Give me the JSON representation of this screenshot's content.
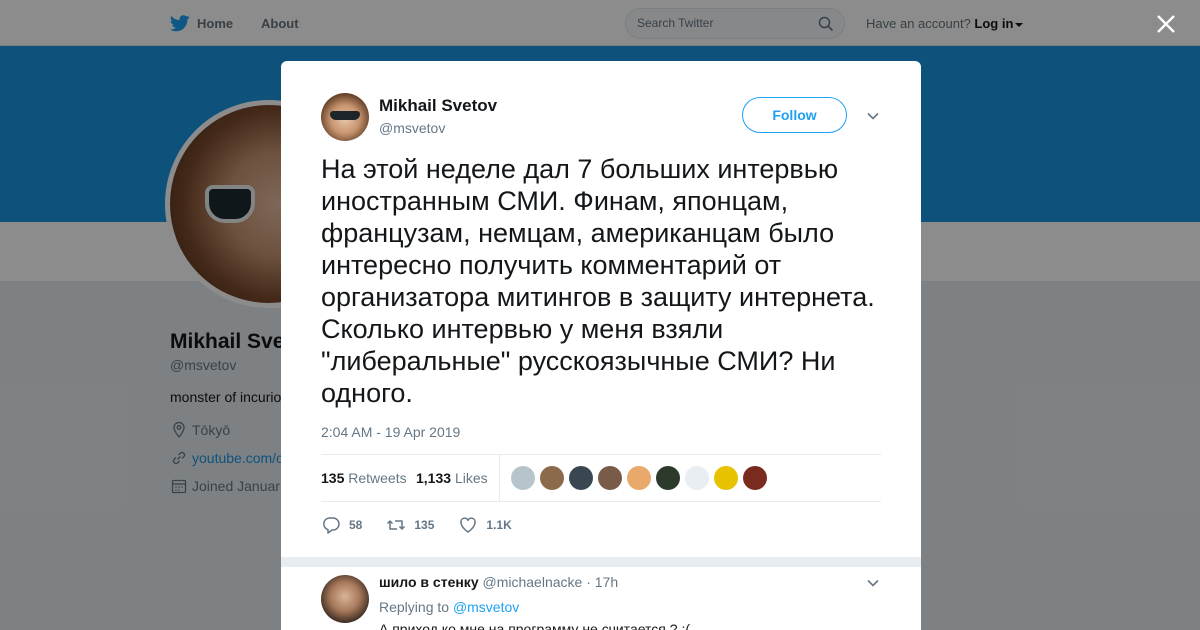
{
  "topbar": {
    "home_label": "Home",
    "about_label": "About",
    "search_placeholder": "Search Twitter",
    "account_prompt": "Have an account?",
    "login_label": "Log in"
  },
  "profile_bg": {
    "name": "Mikhail Sve",
    "handle": "@msvetov",
    "bio": "monster of incurio",
    "location": "Tōkyō",
    "url": "youtube.com/c",
    "joined": "Joined Januar"
  },
  "tweet": {
    "author_name": "Mikhail Svetov",
    "author_handle": "@msvetov",
    "follow_label": "Follow",
    "text": "На этой неделе дал 7 больших интервью иностранным СМИ. Финам, японцам, французам, немцам, американцам было интересно получить комментарий от организатора митингов в защиту интернета. Сколько интервью у меня взяли \"либеральные\" русскоязычные СМИ? Ни одного.",
    "timestamp": "2:04 AM - 19 Apr 2019",
    "retweets_count": "135",
    "retweets_label": "Retweets",
    "likes_count": "1,133",
    "likes_label": "Likes",
    "actions": {
      "replies": "58",
      "retweets": "135",
      "likes": "1.1K"
    },
    "liker_colors": [
      "#b8c4cc",
      "#8a6a4a",
      "#3a4752",
      "#7a5a48",
      "#e8a96a",
      "#2b3a2a",
      "#e8eef2",
      "#e6c200",
      "#7a2a1e"
    ]
  },
  "reply": {
    "author_name": "шило в стенку",
    "author_handle": "@michaelnacke",
    "time": "· 17h",
    "replying_prefix": "Replying to",
    "replying_to": "@msvetov",
    "text": "А приход ко мне на программу не считается ? :("
  }
}
